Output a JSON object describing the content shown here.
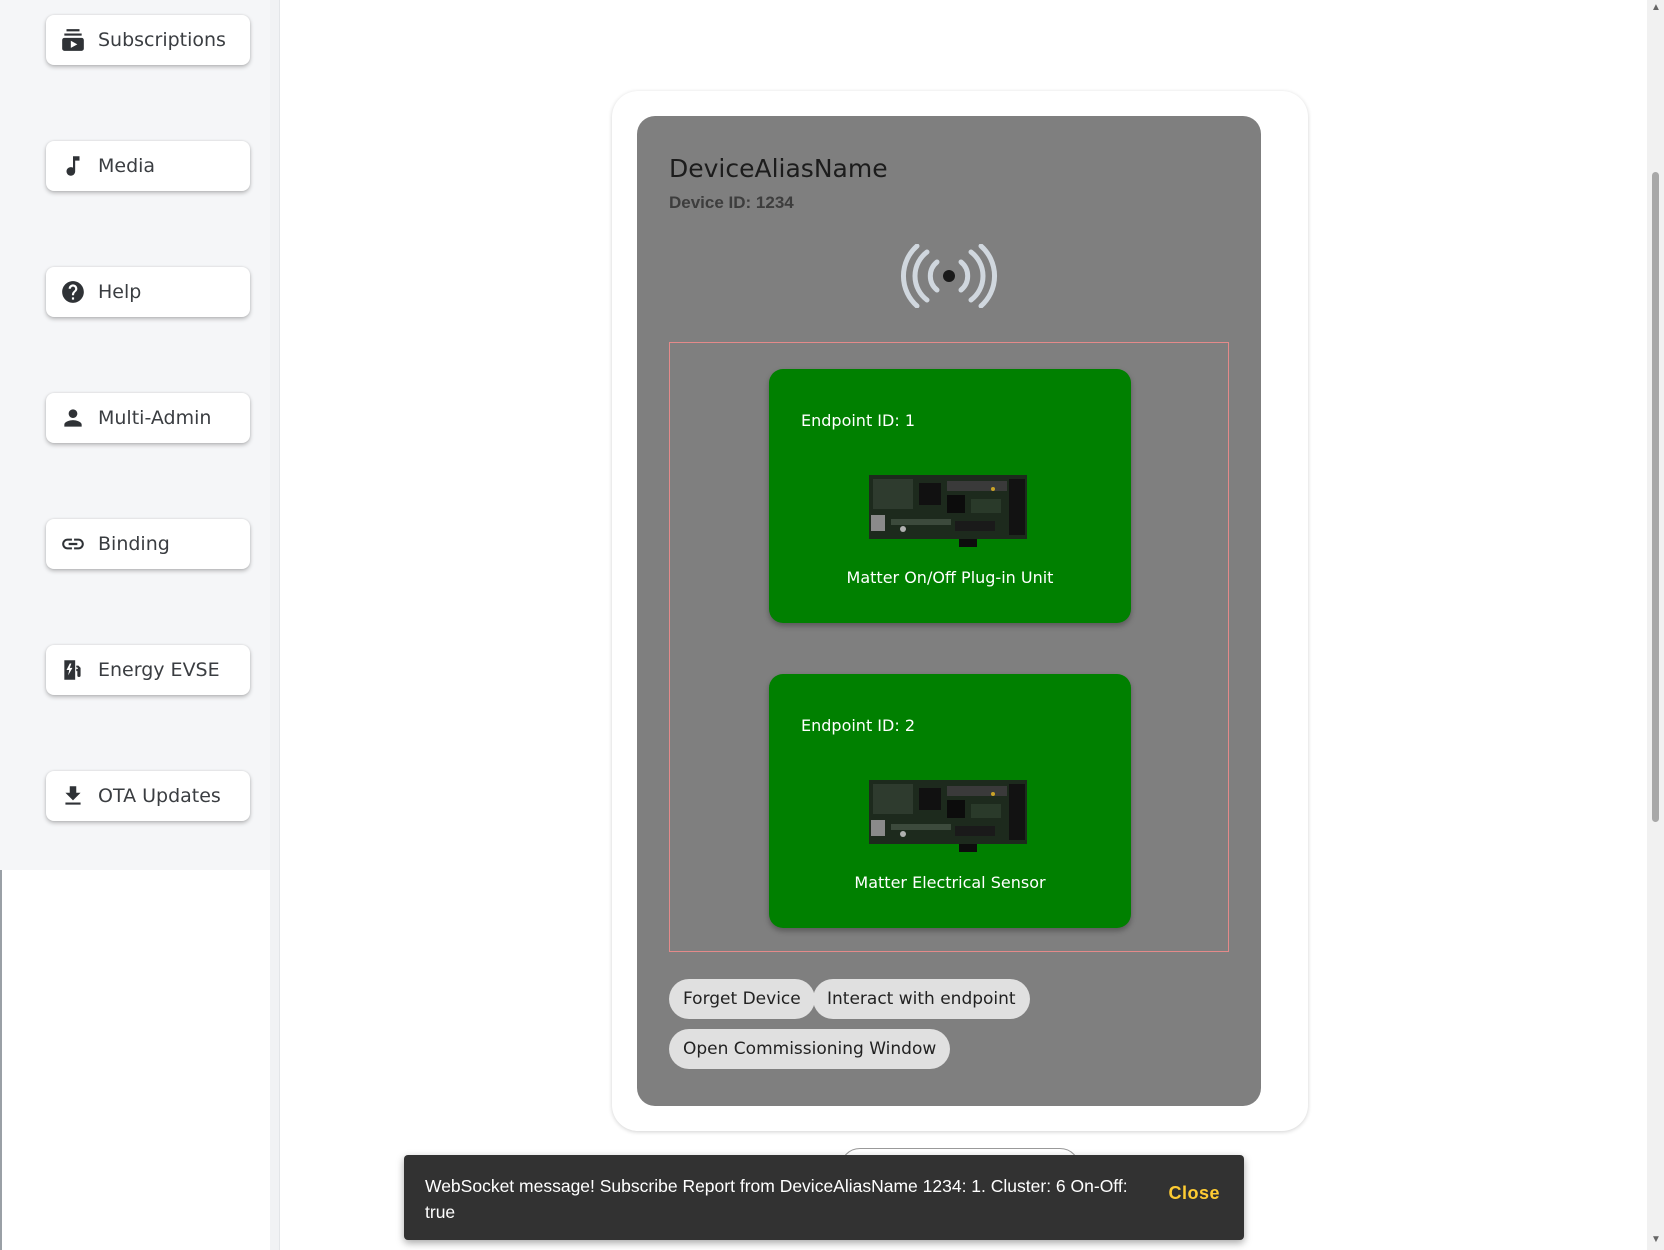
{
  "sidebar": {
    "items": [
      {
        "label": "Subscriptions",
        "icon": "subscriptions-icon"
      },
      {
        "label": "Media",
        "icon": "music-note-icon"
      },
      {
        "label": "Help",
        "icon": "help-icon"
      },
      {
        "label": "Multi-Admin",
        "icon": "person-icon"
      },
      {
        "label": "Binding",
        "icon": "link-icon"
      },
      {
        "label": "Energy EVSE",
        "icon": "ev-charger-icon"
      },
      {
        "label": "OTA Updates",
        "icon": "download-icon"
      }
    ]
  },
  "device": {
    "name": "DeviceAliasName",
    "id_label": "Device ID: 1234",
    "status_icon": "wireless-signal-icon",
    "endpoints": [
      {
        "id_label": "Endpoint ID: 1",
        "name": "Matter On/Off Plug-in Unit",
        "image": "circuit-board-image"
      },
      {
        "id_label": "Endpoint ID: 2",
        "name": "Matter Electrical Sensor",
        "image": "circuit-board-image"
      }
    ],
    "actions": {
      "forget": "Forget Device",
      "interact": "Interact with endpoint",
      "commission": "Open Commissioning Window"
    }
  },
  "snackbar": {
    "message": "WebSocket message! Subscribe Report from DeviceAliasName 1234: 1. Cluster: 6 On-Off: true",
    "close_label": "Close"
  },
  "colors": {
    "endpoint_bg": "#008000",
    "device_card_bg": "#7f7f7f",
    "snackbar_bg": "#323232",
    "snackbar_action": "#ffcc33"
  }
}
